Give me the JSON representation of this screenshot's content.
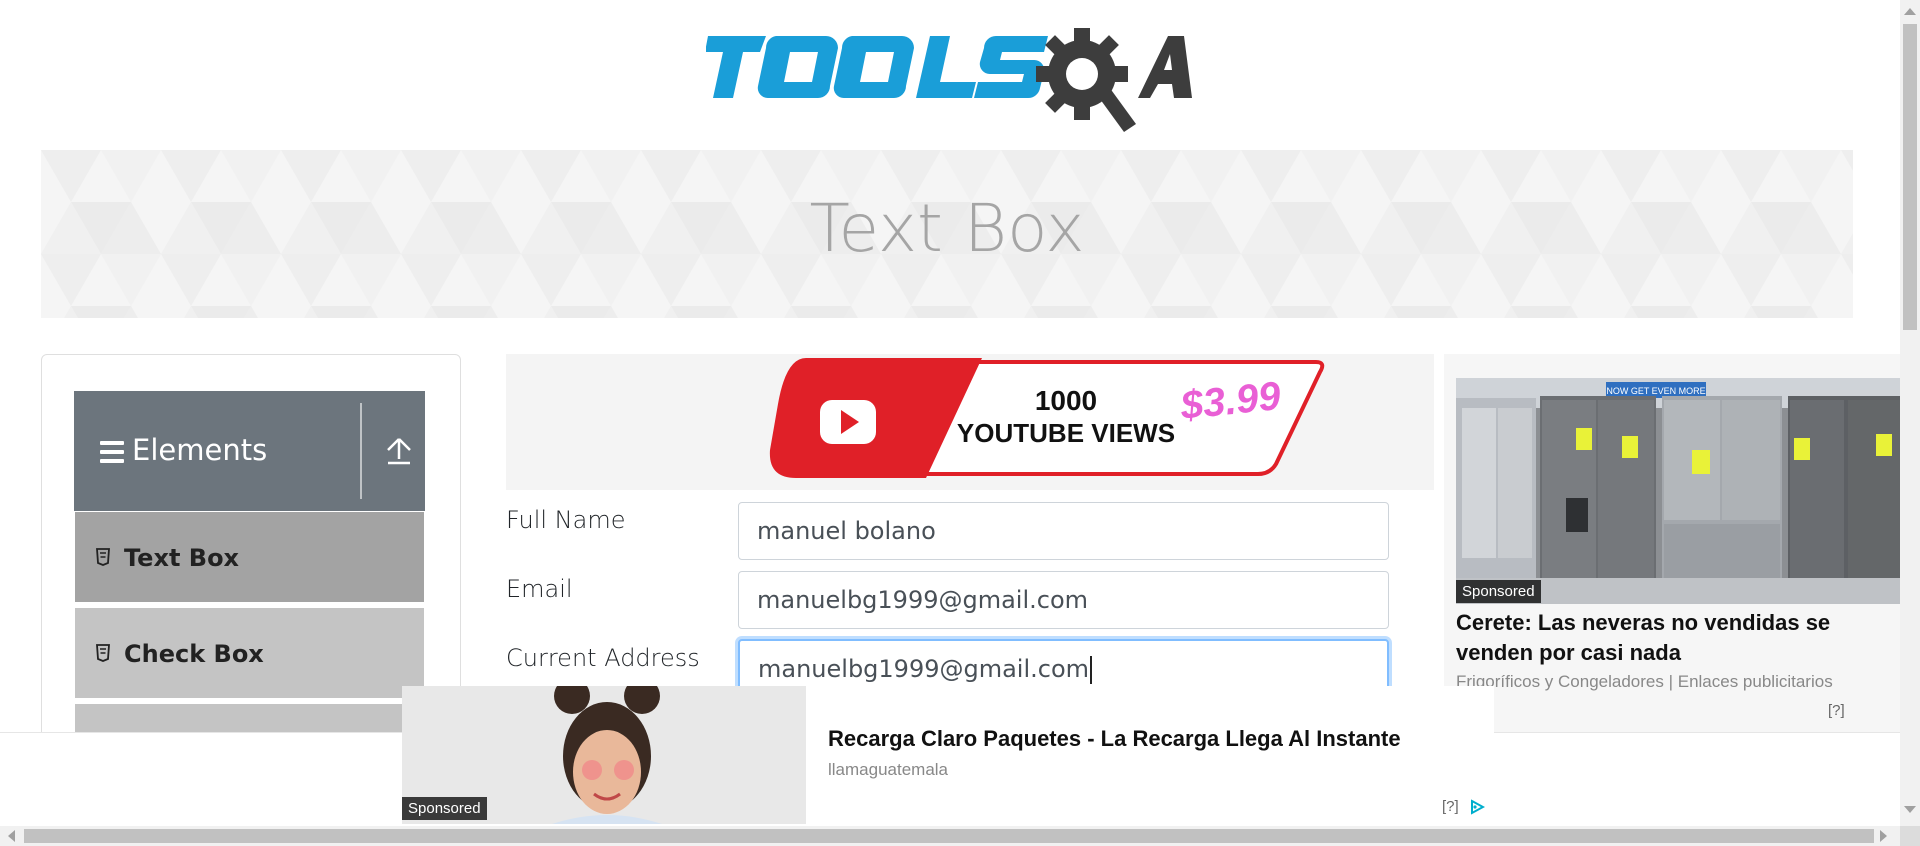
{
  "header": {
    "logo_text": "TOOLSQA"
  },
  "banner": {
    "title": "Text Box"
  },
  "sidebar": {
    "group_title": "Elements",
    "items": [
      {
        "label": "Text Box",
        "active": true
      },
      {
        "label": "Check Box",
        "active": false
      }
    ]
  },
  "ad_top": {
    "line1": "1000",
    "line2": "YOUTUBE VIEWS",
    "price": "$3.99"
  },
  "form": {
    "full_name_label": "Full Name",
    "full_name_value": "manuel bolano",
    "email_label": "Email",
    "email_value": "manuelbg1999@gmail.com",
    "address_label": "Current Address",
    "address_value": "manuelbg1999@gmail.com"
  },
  "ad_right": {
    "sponsored": "Sponsored",
    "badge": "NOW GET EVEN MORE",
    "headline": "Cerete: Las neveras no vendidas se venden por casi nada",
    "source": "Frigoríficos y Congeladores | Enlaces publicitarios",
    "help": "[?]"
  },
  "ad_bottom": {
    "sponsored": "Sponsored",
    "headline": "Recarga Claro Paquetes - La Recarga Llega Al Instante",
    "source": "llamaguatemala",
    "help": "[?]"
  },
  "colors": {
    "brand_blue": "#1a9ed8",
    "brand_dark": "#3d3d3d",
    "sidebar_header": "#6c757d",
    "focus": "#80bdff"
  },
  "icons": [
    "menu-icon",
    "collapse-arrow-icon",
    "html5-icon",
    "youtube-play-icon",
    "adchoices-icon"
  ]
}
